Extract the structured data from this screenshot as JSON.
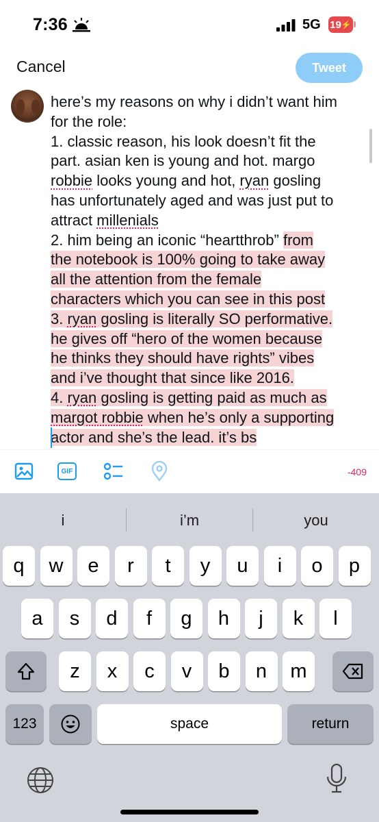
{
  "status_bar": {
    "time": "7:36",
    "network": "5G",
    "battery": "19"
  },
  "header": {
    "cancel_label": "Cancel",
    "tweet_label": "Tweet"
  },
  "composer": {
    "segments": [
      {
        "text": "here’s my reasons on why i didn’t want him\nfor the role:\n1. classic reason, his look doesn’t fit the\npart. asian ken is young and hot. margo\n",
        "style": "normal"
      },
      {
        "text": "robbie",
        "style": "spell"
      },
      {
        "text": " looks young and hot, ",
        "style": "normal"
      },
      {
        "text": "ryan",
        "style": "spell"
      },
      {
        "text": " gosling\nhas unfortunately aged and was just put to\nattract ",
        "style": "normal"
      },
      {
        "text": "millenials",
        "style": "spell"
      },
      {
        "text": "\n2. him being an iconic “heartthrob” ",
        "style": "normal"
      },
      {
        "text": "from\nthe notebook is 100% going to take away\nall the attention from the female\ncharacters which you can see in this post\n3. ",
        "style": "excess"
      },
      {
        "text": "ryan",
        "style": "excess spell"
      },
      {
        "text": " gosling is literally SO performative.\nhe gives off “hero of the women because\nhe thinks they should have rights” vibes\nand i’ve thought that since like 2016.\n4. ",
        "style": "excess"
      },
      {
        "text": "ryan",
        "style": "excess spell"
      },
      {
        "text": " gosling is getting paid as much as\n",
        "style": "excess"
      },
      {
        "text": "margot robbie",
        "style": "excess spell"
      },
      {
        "text": " when he’s only a supporting\nactor and she’s the lead. it’s bs",
        "style": "excess"
      }
    ]
  },
  "toolbar": {
    "icons": [
      "image-icon",
      "gif-icon",
      "poll-icon",
      "location-icon"
    ],
    "gif_label": "GIF",
    "char_count": "-409"
  },
  "keyboard": {
    "suggestions": [
      "i",
      "i’m",
      "you"
    ],
    "row1": [
      "q",
      "w",
      "e",
      "r",
      "t",
      "y",
      "u",
      "i",
      "o",
      "p"
    ],
    "row2": [
      "a",
      "s",
      "d",
      "f",
      "g",
      "h",
      "j",
      "k",
      "l"
    ],
    "row3": [
      "z",
      "x",
      "c",
      "v",
      "b",
      "n",
      "m"
    ],
    "numbers_label": "123",
    "space_label": "space",
    "return_label": "return"
  },
  "colors": {
    "accent": "#1d9bf0",
    "tweet_button_disabled": "#8ecdf7",
    "over_limit_highlight": "#f6d4d6",
    "error": "#e0245e"
  }
}
